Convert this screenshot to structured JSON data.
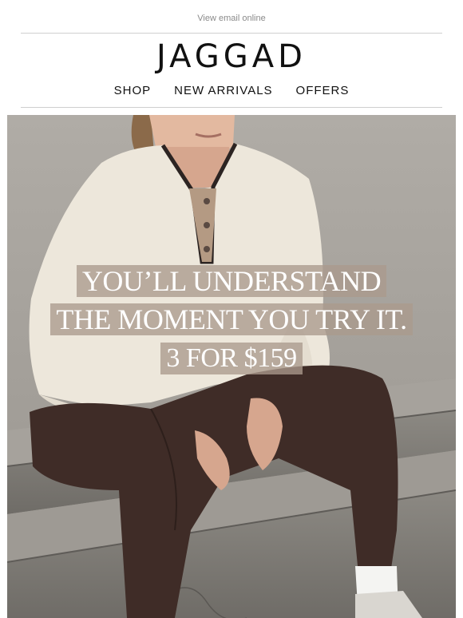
{
  "header": {
    "view_online": "View email online",
    "logo": "JAGGAD"
  },
  "nav": {
    "items": [
      {
        "label": "SHOP"
      },
      {
        "label": "NEW ARRIVALS"
      },
      {
        "label": "OFFERS"
      }
    ]
  },
  "hero": {
    "line1": "YOU’LL UNDERSTAND",
    "line2": "THE MOMENT YOU TRY IT.",
    "line3": "3 FOR $159"
  },
  "colors": {
    "overlay": "#aa9a8d",
    "sweater": "#ede7db",
    "leggings": "#3f2c27",
    "concrete": "#9f9b95"
  }
}
